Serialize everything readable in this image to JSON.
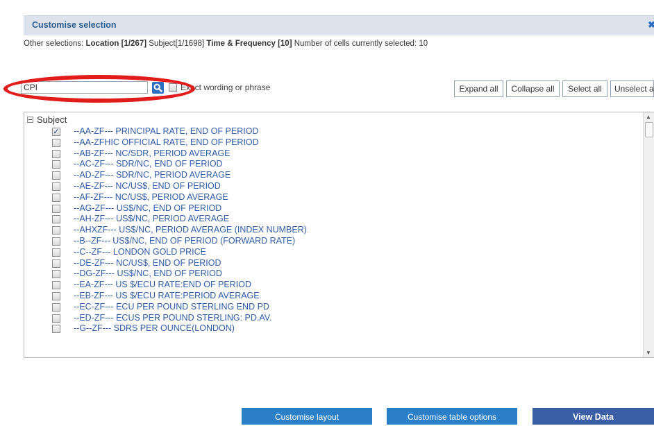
{
  "panel": {
    "title": "Customise selection",
    "close_glyph": "✖"
  },
  "other_selections": {
    "prefix": "Other selections:",
    "location": "Location [1/267]",
    "subject": "Subject[1/1698]",
    "time_frequency": "Time & Frequency [10]",
    "cells": "Number of cells currently selected: 10"
  },
  "search": {
    "value": "CPI",
    "button_icon": "search-icon",
    "exact_label": "Exact wording or phrase",
    "exact_checked": false
  },
  "toolbar": {
    "expand_all": "Expand all",
    "collapse_all": "Collapse all",
    "select_all": "Select all",
    "unselect_all": "Unselect a"
  },
  "tree": {
    "root_label": "Subject",
    "items": [
      {
        "label": "--AA-ZF--- PRINCIPAL RATE, END OF PERIOD",
        "checked": true
      },
      {
        "label": "--AA-ZFHIC OFFICIAL RATE, END OF PERIOD",
        "checked": false
      },
      {
        "label": "--AB-ZF--- NC/SDR, PERIOD AVERAGE",
        "checked": false
      },
      {
        "label": "--AC-ZF--- SDR/NC, END OF PERIOD",
        "checked": false
      },
      {
        "label": "--AD-ZF--- SDR/NC, PERIOD AVERAGE",
        "checked": false
      },
      {
        "label": "--AE-ZF--- NC/US$, END OF PERIOD",
        "checked": false
      },
      {
        "label": "--AF-ZF--- NC/US$, PERIOD AVERAGE",
        "checked": false
      },
      {
        "label": "--AG-ZF--- US$/NC, END OF PERIOD",
        "checked": false
      },
      {
        "label": "--AH-ZF--- US$/NC, PERIOD AVERAGE",
        "checked": false
      },
      {
        "label": "--AHXZF--- US$/NC, PERIOD AVERAGE (INDEX NUMBER)",
        "checked": false
      },
      {
        "label": "--B--ZF--- US$/NC, END OF PERIOD (FORWARD RATE)",
        "checked": false
      },
      {
        "label": "--C--ZF--- LONDON GOLD PRICE",
        "checked": false
      },
      {
        "label": "--DE-ZF--- NC/US$, END OF PERIOD",
        "checked": false
      },
      {
        "label": "--DG-ZF--- US$/NC, END OF PERIOD",
        "checked": false
      },
      {
        "label": "--EA-ZF--- US $/ECU RATE:END OF PERIOD",
        "checked": false
      },
      {
        "label": "--EB-ZF--- US $/ECU RATE:PERIOD AVERAGE",
        "checked": false
      },
      {
        "label": "--EC-ZF--- ECU PER POUND STERLING END PD",
        "checked": false
      },
      {
        "label": "--ED-ZF--- ECUS PER POUND STERLING: PD.AV.",
        "checked": false
      },
      {
        "label": "--G--ZF--- SDRS PER OUNCE(LONDON)",
        "checked": false
      }
    ]
  },
  "footer": {
    "customise_layout": "Customise layout",
    "customise_table": "Customise table options",
    "view_data": "View Data"
  },
  "colors": {
    "accent": "#2a7fc8",
    "highlight": "#e21b1b",
    "link": "#2f5ca8"
  }
}
